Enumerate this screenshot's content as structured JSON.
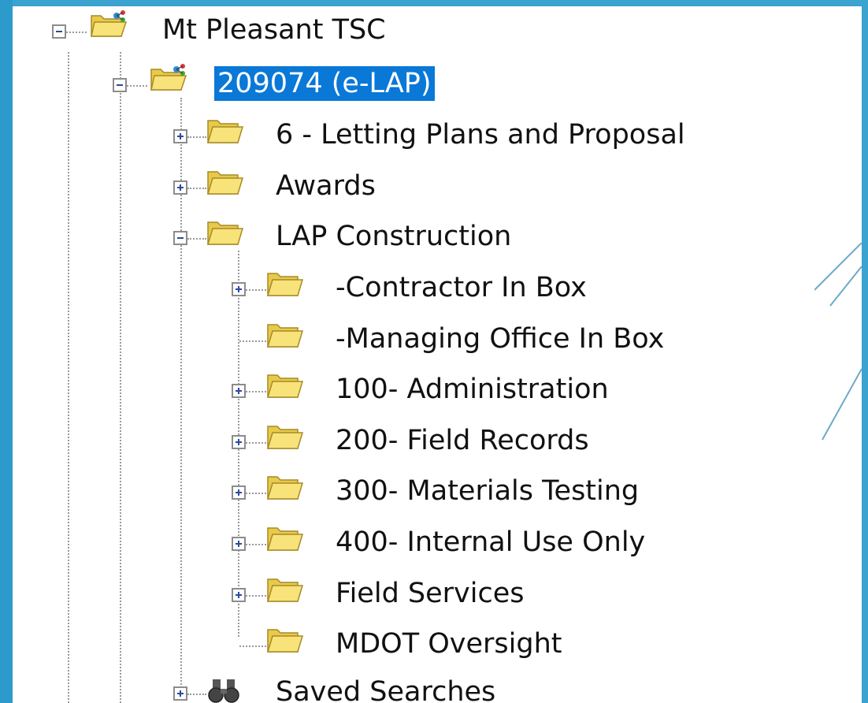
{
  "tree": {
    "root": {
      "label": "Mt Pleasant TSC",
      "icon": "project-folder-icon",
      "expanded": true
    },
    "project": {
      "label": "209074 (e-LAP)",
      "icon": "project-folder-icon",
      "expanded": true,
      "selected": true
    },
    "children": [
      {
        "label": "6 - Letting Plans and Proposal",
        "icon": "folder-icon",
        "expandable": true,
        "expanded": false
      },
      {
        "label": "Awards",
        "icon": "folder-icon",
        "expandable": true,
        "expanded": false
      },
      {
        "label": "LAP Construction",
        "icon": "folder-icon",
        "expandable": true,
        "expanded": true
      }
    ],
    "lap_children": [
      {
        "label": "-Contractor In Box",
        "icon": "folder-icon",
        "expandable": true
      },
      {
        "label": "-Managing Office In Box",
        "icon": "folder-icon",
        "expandable": false
      },
      {
        "label": "100- Administration",
        "icon": "folder-icon",
        "expandable": true
      },
      {
        "label": "200- Field Records",
        "icon": "folder-icon",
        "expandable": true
      },
      {
        "label": "300- Materials Testing",
        "icon": "folder-icon",
        "expandable": true
      },
      {
        "label": "400- Internal Use Only",
        "icon": "folder-icon",
        "expandable": true
      },
      {
        "label": "Field Services",
        "icon": "folder-icon",
        "expandable": true
      },
      {
        "label": "MDOT Oversight",
        "icon": "folder-icon",
        "expandable": false
      }
    ],
    "saved_searches": {
      "label": "Saved Searches",
      "icon": "binoculars-icon",
      "expandable": true
    }
  },
  "colors": {
    "selection": "#0a78d7",
    "background": "#3aa3cf"
  }
}
